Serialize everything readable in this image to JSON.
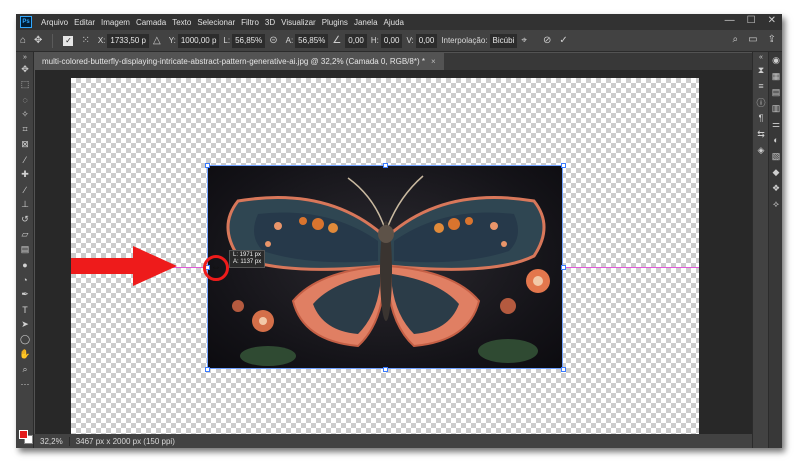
{
  "app": {
    "logo": "Ps"
  },
  "menu": [
    "Arquivo",
    "Editar",
    "Imagem",
    "Camada",
    "Texto",
    "Selecionar",
    "Filtro",
    "3D",
    "Visualizar",
    "Plugins",
    "Janela",
    "Ajuda"
  ],
  "window_controls": {
    "minimize": "—",
    "maximize": "☐",
    "close": "✕"
  },
  "options": {
    "x_label": "X:",
    "x_value": "1733,50 p",
    "y_label": "Y:",
    "y_value": "1000,00 p",
    "l_label": "L:",
    "l_value": "56,85%",
    "a_label": "A:",
    "a_value": "56,85%",
    "angle_value": "0,00",
    "h_label": "H:",
    "h_value": "0,00",
    "v_label": "V:",
    "v_value": "0,00",
    "interp_label": "Interpolação:",
    "interp_value": "Bicúbi"
  },
  "document": {
    "tab_title": "multi-colored-butterfly-displaying-intricate-abstract-pattern-generative-ai.jpg @ 32,2% (Camada 0, RGB/8*) *",
    "close": "×"
  },
  "transform_readout": {
    "l": "L: 1971 px",
    "a": "A: 1137 px"
  },
  "status": {
    "zoom": "32,2%",
    "info": "3467 px x 2000 px (150 ppi)"
  },
  "colors": {
    "foreground": "#e31b1b",
    "background": "#ffffff",
    "guide": "#e05ad8",
    "annotation": "#ee1b1b"
  }
}
